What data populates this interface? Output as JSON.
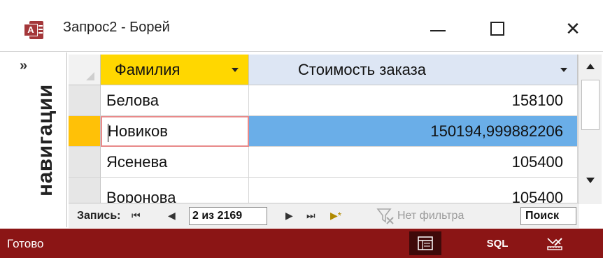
{
  "window": {
    "app_icon": "access-icon",
    "app_icon_letter": "A",
    "title": "Запрос2 - Борей",
    "controls": [
      "minimize-icon",
      "maximize-icon",
      "close-icon"
    ],
    "close_glyph": "✕"
  },
  "nav_pane": {
    "toggle_glyph": "»",
    "label": "навигации"
  },
  "datasheet": {
    "columns": [
      {
        "label": "Фамилия",
        "highlighted": true
      },
      {
        "label": "Стоимость заказа",
        "highlighted": false
      }
    ],
    "rows": [
      {
        "name": "Белова",
        "value": "158100"
      },
      {
        "name": "Новиков",
        "value": "150194,999882206"
      },
      {
        "name": "Ясенева",
        "value": "105400"
      },
      {
        "name": "Воронова",
        "value": "105400"
      }
    ],
    "current_row_index": 1,
    "colors": {
      "header_active": "#ffd700",
      "header_inactive": "#dde6f4",
      "selection": "#6aaee8",
      "record_selector_current": "#ffc107"
    }
  },
  "record_nav": {
    "label": "Запись:",
    "first_glyph": "⏮",
    "prev_glyph": "◀",
    "current": "2 из 2169",
    "next_glyph": "▶",
    "last_glyph": "⏭",
    "new_glyph": "▶*",
    "filter_icon": "filter-off-icon",
    "filter_label": "Нет фильтра",
    "search_label": "Поиск"
  },
  "status_bar": {
    "text": "Готово",
    "views": [
      {
        "name": "datasheet-view",
        "icon": "datasheet-icon",
        "active": true
      },
      {
        "name": "sql-view",
        "label": "SQL",
        "active": false
      },
      {
        "name": "design-view",
        "icon": "design-icon",
        "active": false
      }
    ],
    "color": "#8b1515"
  }
}
